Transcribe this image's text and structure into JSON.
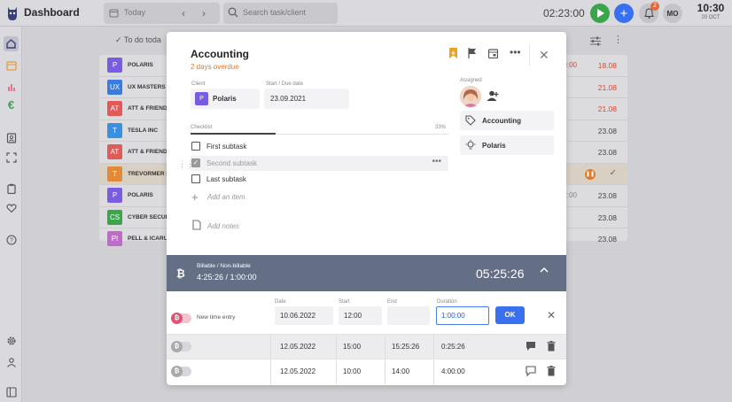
{
  "app": {
    "title": "Dashboard"
  },
  "topbar": {
    "date_label": "Today",
    "search_placeholder": "Search task/client",
    "timer": "02:23:00",
    "notifications_count": "2",
    "user_initials": "MO",
    "clock_time": "10:30",
    "clock_date": "20 OCT"
  },
  "background": {
    "section_label": "To do toda",
    "rows": [
      {
        "initials": "P",
        "name": "POLARIS",
        "extra": "@9:00",
        "date": "18.08",
        "color": "#7a5ce0",
        "date_red": true,
        "extra_red": true
      },
      {
        "initials": "UX",
        "name": "UX MASTERS",
        "extra": "",
        "date": "21.08",
        "color": "#3a7be0",
        "date_red": true
      },
      {
        "initials": "AT",
        "name": "ATT & FRIENDS",
        "extra": "",
        "date": "21.08",
        "color": "#e05a5a",
        "date_red": true
      },
      {
        "initials": "T",
        "name": "TESLA INC",
        "extra": "",
        "date": "23.08",
        "color": "#3a8fe0",
        "date_red": false
      },
      {
        "initials": "AT",
        "name": "ATT & FRIENDS",
        "extra": "",
        "date": "23.08",
        "color": "#e05a5a",
        "date_red": false
      },
      {
        "initials": "T",
        "name": "TREVORMER INC",
        "extra": "",
        "date": "",
        "color": "#e08a3a",
        "date_red": false
      },
      {
        "initials": "P",
        "name": "POLARIS",
        "extra": "@12:00",
        "date": "23.08",
        "color": "#7a5ce0",
        "date_red": false
      },
      {
        "initials": "CS",
        "name": "CYBER SECURITY",
        "extra": "",
        "date": "23.08",
        "color": "#3aa64c",
        "date_red": false
      },
      {
        "initials": "PI",
        "name": "PELL & ICARUS",
        "extra": "",
        "date": "23.08",
        "color": "#c06acb",
        "date_red": false
      }
    ]
  },
  "task": {
    "title": "Accounting",
    "subtitle": "2 days overdue",
    "client_label": "Client",
    "client_initial": "P",
    "client_name": "Polaris",
    "date_label": "Start / Due date",
    "date_value": "23.09.2021",
    "assigned_label": "Assigned",
    "tags": [
      "Accounting",
      "Polaris"
    ],
    "checklist_label": "Checklist",
    "checklist_progress": "33%",
    "checklist_progress_value": 0.33,
    "checklist": [
      {
        "text": "First subtask",
        "done": false
      },
      {
        "text": "Second subtask",
        "done": true
      },
      {
        "text": "Last subtask",
        "done": false
      }
    ],
    "add_item": "Add an item",
    "add_notes": "Add notes"
  },
  "timer_band": {
    "label": "Billable / Non-billable",
    "value": "4:25:26 / 1:00:00",
    "total": "05:25:26"
  },
  "entries": {
    "headers": {
      "date": "Date",
      "start": "Start",
      "end": "End",
      "duration": "Duration"
    },
    "new_entry": {
      "label": "New time entry",
      "date": "10.06.2022",
      "start": "12:00",
      "end": "",
      "duration": "1:00:00",
      "ok_label": "OK"
    },
    "rows": [
      {
        "date": "12.05.2022",
        "start": "15:00",
        "end": "15:25:26",
        "duration": "0:25:26"
      },
      {
        "date": "12.05.2022",
        "start": "10:00",
        "end": "14:00",
        "duration": "4:00:00"
      }
    ]
  },
  "colors": {
    "accent": "#3a6ff0",
    "overdue": "#e07a2c",
    "play": "#3aa64c",
    "band": "#646f86"
  }
}
